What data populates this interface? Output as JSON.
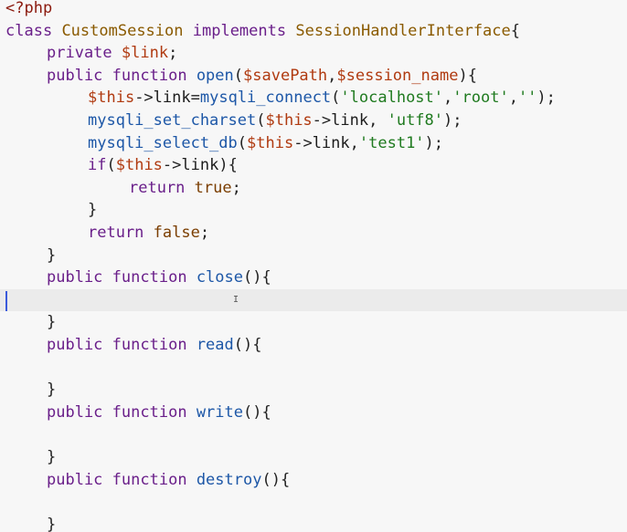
{
  "editor": {
    "lines": [
      {
        "indent": 0,
        "tokens": [
          [
            "tag",
            "<?php"
          ]
        ]
      },
      {
        "indent": 0,
        "tokens": [
          [
            "kw",
            "class"
          ],
          [
            "pl",
            " "
          ],
          [
            "cls",
            "CustomSession"
          ],
          [
            "pl",
            " "
          ],
          [
            "kw",
            "implements"
          ],
          [
            "pl",
            " "
          ],
          [
            "cls",
            "SessionHandlerInterface"
          ],
          [
            "punc",
            "{"
          ]
        ]
      },
      {
        "indent": 1,
        "tokens": [
          [
            "kw",
            "private"
          ],
          [
            "pl",
            " "
          ],
          [
            "var",
            "$link"
          ],
          [
            "punc",
            ";"
          ]
        ]
      },
      {
        "indent": 1,
        "tokens": [
          [
            "kw",
            "public"
          ],
          [
            "pl",
            " "
          ],
          [
            "kw",
            "function"
          ],
          [
            "pl",
            " "
          ],
          [
            "fn",
            "open"
          ],
          [
            "punc",
            "("
          ],
          [
            "var",
            "$savePath"
          ],
          [
            "punc",
            ","
          ],
          [
            "var",
            "$session_name"
          ],
          [
            "punc",
            "){"
          ]
        ]
      },
      {
        "indent": 2,
        "tokens": [
          [
            "var",
            "$this"
          ],
          [
            "punc",
            "->"
          ],
          [
            "pl",
            "link"
          ],
          [
            "punc",
            "="
          ],
          [
            "fn",
            "mysqli_connect"
          ],
          [
            "punc",
            "("
          ],
          [
            "str",
            "'localhost'"
          ],
          [
            "punc",
            ","
          ],
          [
            "str",
            "'root'"
          ],
          [
            "punc",
            ","
          ],
          [
            "str",
            "''"
          ],
          [
            "punc",
            ");"
          ]
        ]
      },
      {
        "indent": 2,
        "tokens": [
          [
            "fn",
            "mysqli_set_charset"
          ],
          [
            "punc",
            "("
          ],
          [
            "var",
            "$this"
          ],
          [
            "punc",
            "->"
          ],
          [
            "pl",
            "link"
          ],
          [
            "punc",
            ", "
          ],
          [
            "str",
            "'utf8'"
          ],
          [
            "punc",
            ");"
          ]
        ]
      },
      {
        "indent": 2,
        "tokens": [
          [
            "fn",
            "mysqli_select_db"
          ],
          [
            "punc",
            "("
          ],
          [
            "var",
            "$this"
          ],
          [
            "punc",
            "->"
          ],
          [
            "pl",
            "link"
          ],
          [
            "punc",
            ","
          ],
          [
            "str",
            "'test1'"
          ],
          [
            "punc",
            ");"
          ]
        ]
      },
      {
        "indent": 2,
        "tokens": [
          [
            "kw",
            "if"
          ],
          [
            "punc",
            "("
          ],
          [
            "var",
            "$this"
          ],
          [
            "punc",
            "->"
          ],
          [
            "pl",
            "link"
          ],
          [
            "punc",
            "){"
          ]
        ]
      },
      {
        "indent": 3,
        "tokens": [
          [
            "kw",
            "return"
          ],
          [
            "pl",
            " "
          ],
          [
            "def",
            "true"
          ],
          [
            "punc",
            ";"
          ]
        ]
      },
      {
        "indent": 2,
        "tokens": [
          [
            "punc",
            "}"
          ]
        ]
      },
      {
        "indent": 2,
        "tokens": [
          [
            "kw",
            "return"
          ],
          [
            "pl",
            " "
          ],
          [
            "def",
            "false"
          ],
          [
            "punc",
            ";"
          ]
        ]
      },
      {
        "indent": 1,
        "tokens": [
          [
            "punc",
            "}"
          ]
        ]
      },
      {
        "indent": 1,
        "tokens": [
          [
            "kw",
            "public"
          ],
          [
            "pl",
            " "
          ],
          [
            "kw",
            "function"
          ],
          [
            "pl",
            " "
          ],
          [
            "fn",
            "close"
          ],
          [
            "punc",
            "(){"
          ]
        ]
      },
      {
        "indent": 0,
        "tokens": [],
        "current": true
      },
      {
        "indent": 1,
        "tokens": [
          [
            "punc",
            "}"
          ]
        ]
      },
      {
        "indent": 1,
        "tokens": [
          [
            "kw",
            "public"
          ],
          [
            "pl",
            " "
          ],
          [
            "kw",
            "function"
          ],
          [
            "pl",
            " "
          ],
          [
            "fn",
            "read"
          ],
          [
            "punc",
            "(){"
          ]
        ]
      },
      {
        "indent": 0,
        "tokens": []
      },
      {
        "indent": 1,
        "tokens": [
          [
            "punc",
            "}"
          ]
        ]
      },
      {
        "indent": 1,
        "tokens": [
          [
            "kw",
            "public"
          ],
          [
            "pl",
            " "
          ],
          [
            "kw",
            "function"
          ],
          [
            "pl",
            " "
          ],
          [
            "fn",
            "write"
          ],
          [
            "punc",
            "(){"
          ]
        ]
      },
      {
        "indent": 0,
        "tokens": []
      },
      {
        "indent": 1,
        "tokens": [
          [
            "punc",
            "}"
          ]
        ]
      },
      {
        "indent": 1,
        "tokens": [
          [
            "kw",
            "public"
          ],
          [
            "pl",
            " "
          ],
          [
            "kw",
            "function"
          ],
          [
            "pl",
            " "
          ],
          [
            "fn",
            "destroy"
          ],
          [
            "punc",
            "(){"
          ]
        ]
      },
      {
        "indent": 0,
        "tokens": []
      },
      {
        "indent": 1,
        "tokens": [
          [
            "punc",
            "}"
          ]
        ]
      }
    ]
  }
}
